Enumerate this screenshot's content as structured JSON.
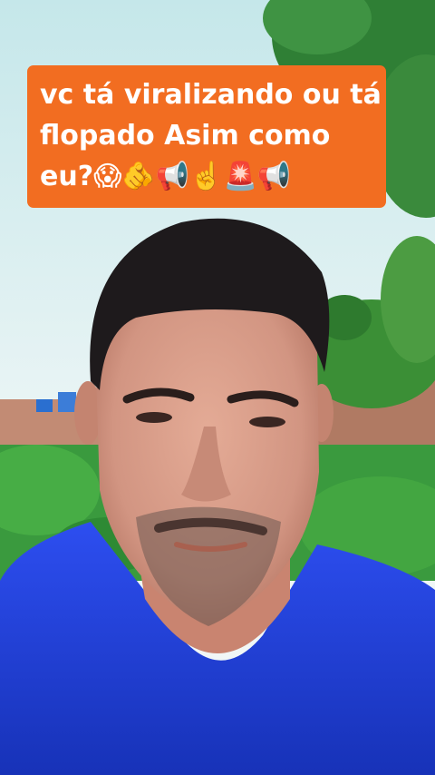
{
  "caption": {
    "lines": [
      "vc tá viralizando ou tá",
      "flopado Asim como",
      "eu?😱🫵📢☝️🚨📢"
    ],
    "background": "#f26d21",
    "text_color": "#ffffff"
  },
  "scene": {
    "sky": "#dfeff0",
    "foliage": "#2f8f3a",
    "wall": "#b07a63",
    "shirt": "#1f3fd6",
    "skin": "#d39a86",
    "hair": "#1e1a1c"
  }
}
